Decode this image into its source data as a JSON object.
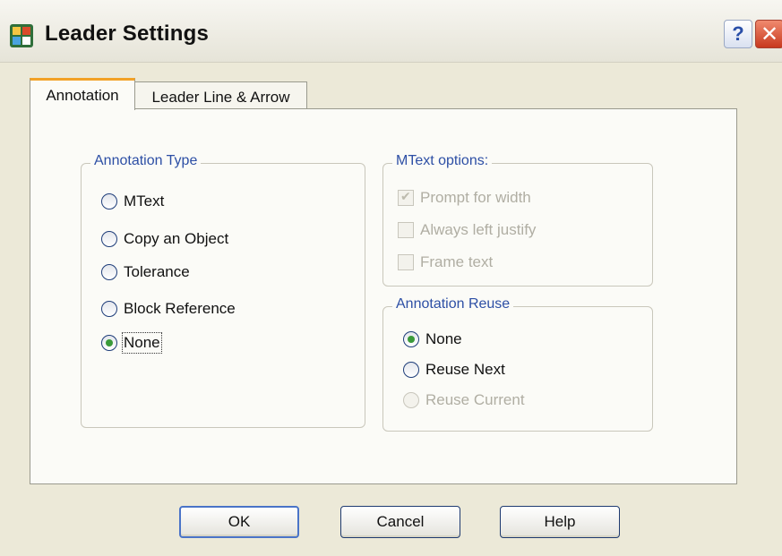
{
  "window": {
    "title": "Leader Settings",
    "help_label": "?",
    "close_label": "✕"
  },
  "tabs": [
    {
      "label": "Annotation",
      "active": true
    },
    {
      "label": "Leader Line & Arrow",
      "active": false
    }
  ],
  "annotation_type": {
    "title": "Annotation Type",
    "options": [
      {
        "label": "MText",
        "checked": false
      },
      {
        "label": "Copy an Object",
        "checked": false
      },
      {
        "label": "Tolerance",
        "checked": false
      },
      {
        "label": "Block Reference",
        "checked": false
      },
      {
        "label": "None",
        "checked": true
      }
    ]
  },
  "mtext_options": {
    "title": "MText options:",
    "items": [
      {
        "label": "Prompt for width",
        "checked": true,
        "enabled": false
      },
      {
        "label": "Always left justify",
        "checked": false,
        "enabled": false
      },
      {
        "label": "Frame text",
        "checked": false,
        "enabled": false
      }
    ]
  },
  "annotation_reuse": {
    "title": "Annotation Reuse",
    "options": [
      {
        "label": "None",
        "checked": true,
        "enabled": true
      },
      {
        "label": "Reuse Next",
        "checked": false,
        "enabled": true
      },
      {
        "label": "Reuse Current",
        "checked": false,
        "enabled": false
      }
    ]
  },
  "buttons": {
    "ok": "OK",
    "cancel": "Cancel",
    "help": "Help"
  },
  "colors": {
    "group_title": "#2d4fa5",
    "active_tab_accent": "#f2a227",
    "radio_selected": "#3a9a3a",
    "disabled_text": "#b0aea3"
  }
}
